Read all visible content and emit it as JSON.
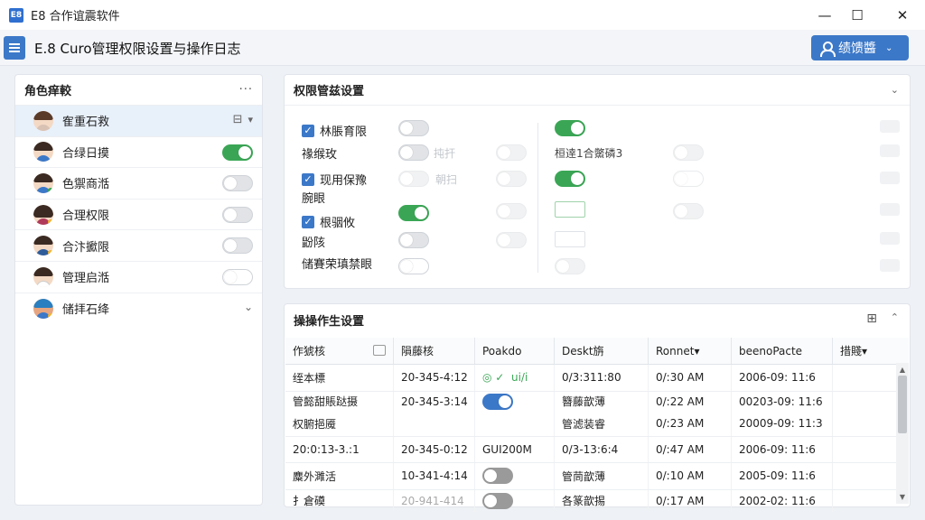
{
  "window": {
    "app_icon_text": "E8",
    "title": "E8 合作谊震软件",
    "minimize": "—",
    "maximize": "☐",
    "close": "✕"
  },
  "header": {
    "page_title": "E.8 Curo管理权限设置与操作日志",
    "user_button_label": "绩馈醬",
    "user_button_chevron": "⌄"
  },
  "roles_panel": {
    "title": "角色痒較",
    "more": "···",
    "items": [
      {
        "name": "隺重石救",
        "selected": true,
        "has_toggle": false
      },
      {
        "name": "合绿日摸",
        "toggle_on": true
      },
      {
        "name": "色禦商湉",
        "toggle_on": false
      },
      {
        "name": "合理权限",
        "toggle_on": false
      },
      {
        "name": "合汴擨限",
        "toggle_on": false
      },
      {
        "name": "管理启湉",
        "toggle_on": false
      },
      {
        "name": "储拝石绛",
        "has_chevron": true
      }
    ]
  },
  "perm_panel": {
    "title": "权限管兹设置",
    "chevron": "⌄",
    "items": [
      {
        "label": "林脹育限",
        "checked": true
      },
      {
        "label": "禒缑玫",
        "checked": false
      },
      {
        "label": "现用保豫",
        "checked": true
      },
      {
        "label": "腕眼",
        "checked": false
      },
      {
        "label": "根骃攸",
        "checked": true
      },
      {
        "label": "鼢陔",
        "checked": false
      },
      {
        "label": "储賽荣瑱禁眼",
        "checked": false
      }
    ],
    "ghost_text_1": "扽扞",
    "ghost_text_2": "朝扫",
    "right_label": "桓逹1合鱉磷3"
  },
  "ops_panel": {
    "title": "操操作生设置",
    "chevron_up": "⌃",
    "columns": [
      "作猇核",
      "隕藤核",
      "Poakdo",
      "Deskt旃",
      "Ronnet▾",
      "beenoPacte",
      "措賤▾"
    ],
    "rows": [
      [
        "绖本標",
        "20-345-4:12",
        "",
        "0/3:311:80",
        "0/:30 AM",
        "2006-09: 11:6",
        ""
      ],
      [
        "管懿甜賬跶摄",
        "20-345-3:14",
        "",
        "簪藤歆薄",
        "0/:22 AM",
        "00203-09: 11:6",
        ""
      ],
      [
        "权腑挹魇",
        "",
        "",
        "管滤装睿",
        "0/:23 AM",
        "20009-09: 11:3",
        ""
      ],
      [
        "20:0:13-3.:1",
        "20-345-0:12",
        "GUI200M",
        "0/3-13:6:4",
        "0/:47 AM",
        "2006-09: 11:6",
        ""
      ],
      [
        "麋外濉活",
        "10-341-4:14",
        "",
        "管茼歆薄",
        "0/:10 AM",
        "2005-09: 11:6",
        ""
      ],
      [
        "扌倉磸",
        "20-941-414",
        "",
        "各篆歆掦",
        "0/:17 AM",
        "2002-02: 11:6",
        ""
      ]
    ],
    "row_extra": {
      "row0_col2_text": "◎ ✓  ui/i"
    }
  },
  "colors": {
    "accent_blue": "#3c78c8",
    "toggle_green": "#3aa655",
    "selected_row": "#e8f0fa"
  }
}
